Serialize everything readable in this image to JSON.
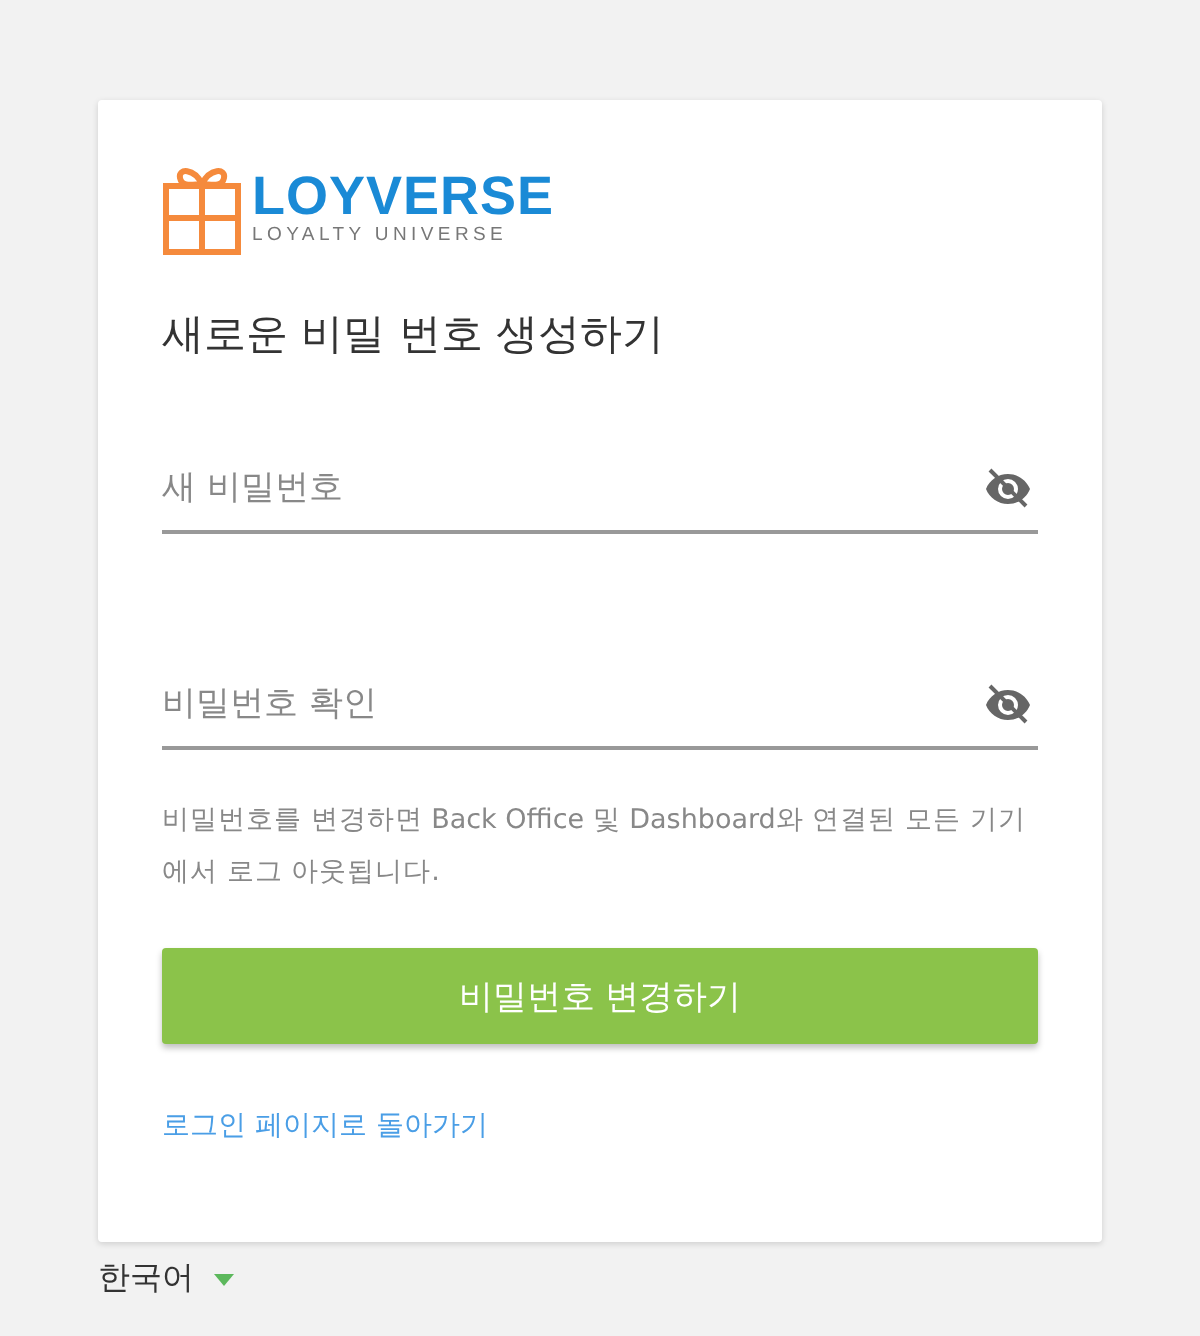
{
  "logo": {
    "name": "LOYVERSE",
    "tagline": "LOYALTY UNIVERSE"
  },
  "title": "새로운 비밀 번호 생성하기",
  "fields": [
    {
      "placeholder": "새 비밀번호",
      "password_visible": false
    },
    {
      "placeholder": "비밀번호 확인",
      "password_visible": false
    }
  ],
  "notice": "비밀번호를 변경하면 Back Office 및 Dashboard와 연결된 모든 기기에서 로그 아웃됩니다.",
  "submit_button": "비밀번호 변경하기",
  "back_link": "로그인 페이지로 돌아가기",
  "language": "한국어"
}
